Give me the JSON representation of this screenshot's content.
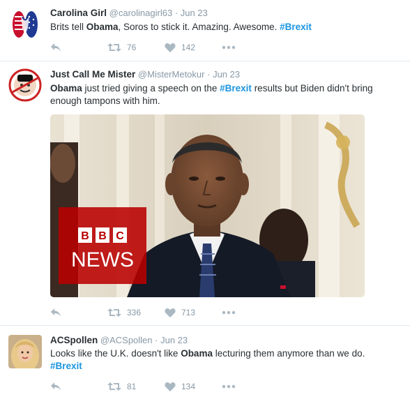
{
  "tweets": [
    {
      "name": "Carolina Girl",
      "handle": "@carolinagirl63",
      "dot": "·",
      "time": "Jun 23",
      "text": {
        "t1": "Brits tell ",
        "b1": "Obama",
        "t2": ", Soros to stick it. Amazing. Awesome. ",
        "tag": "#Brexit"
      },
      "retweets": "76",
      "likes": "142"
    },
    {
      "name": "Just Call Me Mister",
      "handle": "@MisterMetokur",
      "dot": "·",
      "time": "Jun 23",
      "text": {
        "b1": "Obama",
        "t1": " just tried giving a speech on the ",
        "tag": "#Brexit",
        "t2": " results but Biden didn't bring enough tampons with him."
      },
      "media": {
        "logo_top": "BBC",
        "logo_bottom": "NEWS"
      },
      "retweets": "336",
      "likes": "713"
    },
    {
      "name": "ACSpollen",
      "handle": "@ACSpollen",
      "dot": "·",
      "time": "Jun 23",
      "text": {
        "t1": "Looks like the U.K. doesn't like ",
        "b1": "Obama",
        "t2": " lecturing them anymore than we do.",
        "tag": "#Brexit"
      },
      "retweets": "81",
      "likes": "134"
    }
  ],
  "colors": {
    "hashtag": "#1b95e0",
    "meta": "#8899a6",
    "text": "#292f33",
    "divider": "#e1e8ed",
    "bbc_red": "#b80000"
  },
  "icons": [
    "reply-icon",
    "retweet-icon",
    "like-icon",
    "more-icon"
  ]
}
